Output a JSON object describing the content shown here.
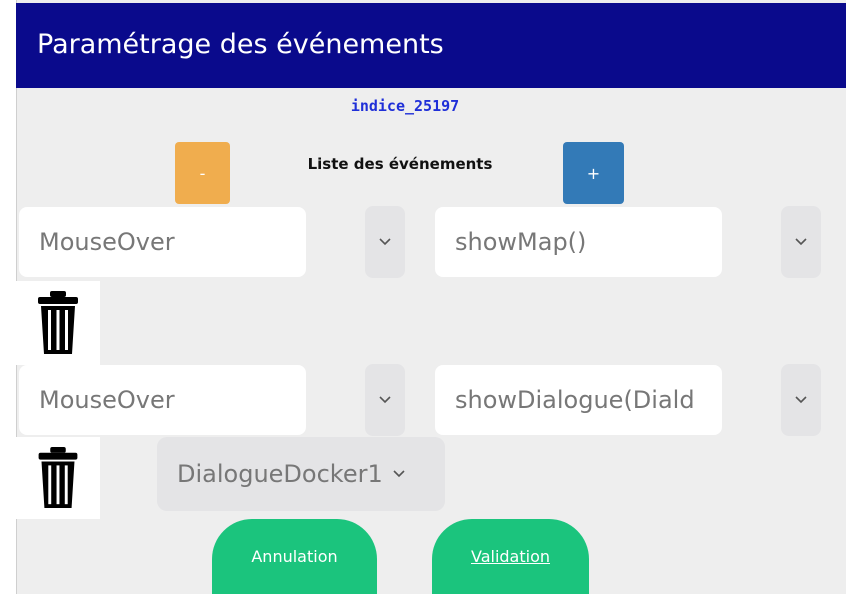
{
  "header": {
    "title": "Paramétrage des événements"
  },
  "indice": "indice_25197",
  "list": {
    "title": "Liste des événements",
    "minus_label": "-",
    "plus_label": "+"
  },
  "events": [
    {
      "event": "MouseOver",
      "action": "showMap()"
    },
    {
      "event": "MouseOver",
      "action": "showDialogue(Diald",
      "param": "DialogueDocker1"
    }
  ],
  "buttons": {
    "cancel": "Annulation",
    "validate": "Validation"
  },
  "icons": {
    "delete": "trash-icon",
    "dropdown": "chevron-down-icon"
  },
  "colors": {
    "header_bg": "#0a0a8c",
    "minus_bg": "#f0ad4e",
    "plus_bg": "#337ab7",
    "action_green": "#1bc47d"
  }
}
